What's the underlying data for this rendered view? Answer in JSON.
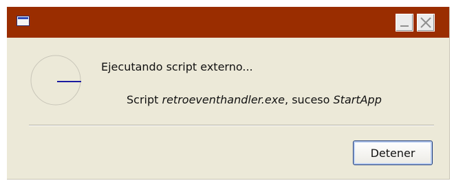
{
  "dialog": {
    "message": "Ejecutando script externo...",
    "detail": {
      "prefix": "Script ",
      "script_name": "retroeventhandler.exe",
      "middle": ", suceso ",
      "event_name": "StartApp"
    },
    "stop_button_label": "Detener"
  },
  "icons": {
    "title": "window-icon",
    "minimize": "minimize-icon",
    "close": "close-icon",
    "spinner": "spinner-icon"
  },
  "colors": {
    "titlebar": "#9A2D00",
    "dialog_bg": "#ECE9D8",
    "spinner_hand": "#1a1aa0"
  }
}
